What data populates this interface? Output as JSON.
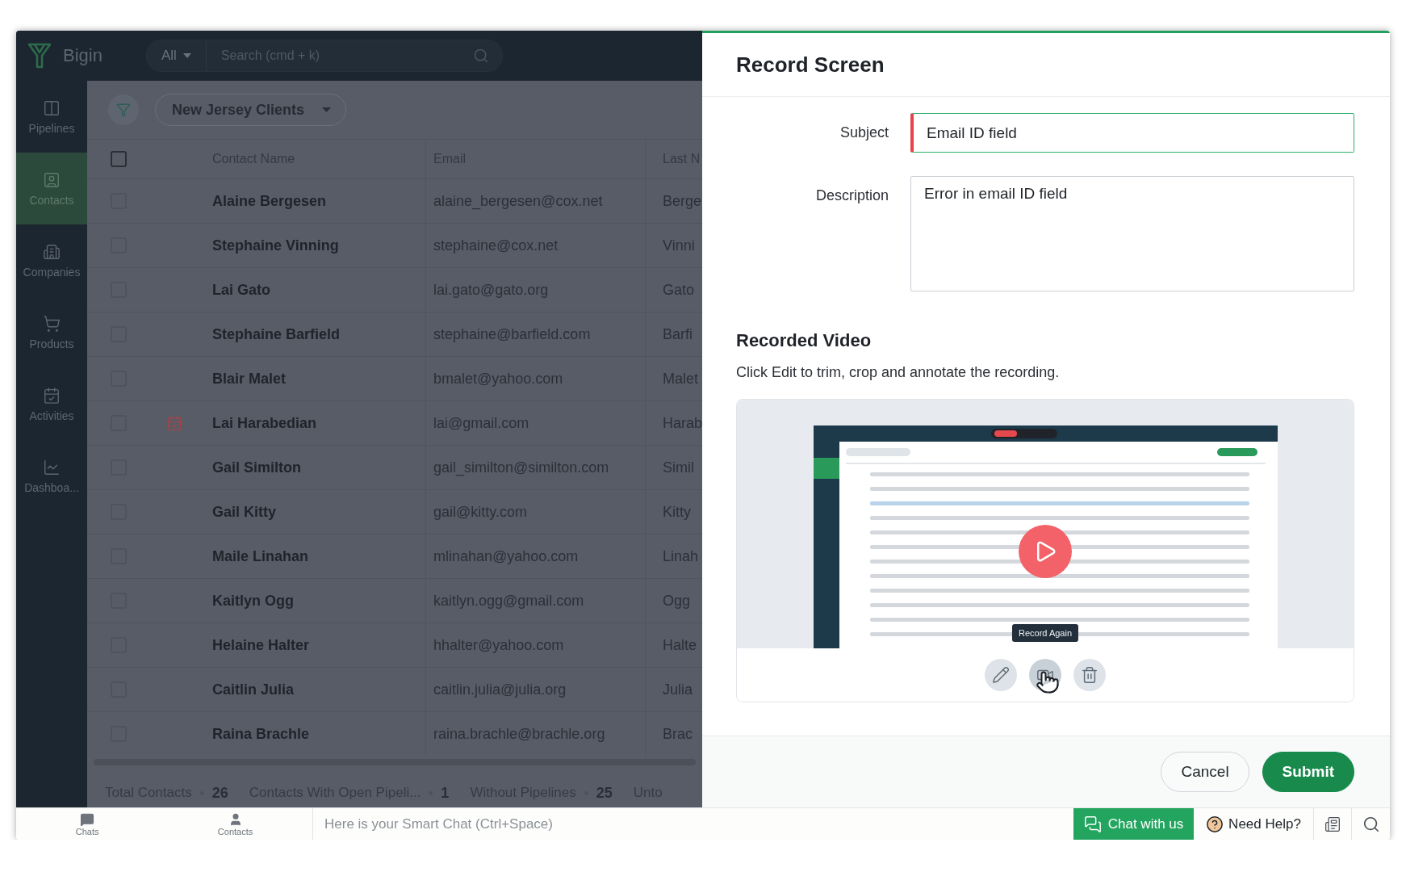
{
  "header": {
    "logo": "Bigin",
    "scope": "All",
    "search_placeholder": "Search (cmd + k)"
  },
  "sidebar": {
    "items": [
      {
        "label": "Pipelines",
        "selected": false
      },
      {
        "label": "Contacts",
        "selected": true
      },
      {
        "label": "Companies",
        "selected": false
      },
      {
        "label": "Products",
        "selected": false
      },
      {
        "label": "Activities",
        "selected": false
      },
      {
        "label": "Dashboa...",
        "selected": false
      }
    ]
  },
  "toolbar": {
    "view": "New Jersey Clients"
  },
  "table": {
    "select_all": {
      "checked": false
    },
    "columns": [
      "Contact Name",
      "Email",
      "Last N"
    ],
    "rows": [
      {
        "checked": false,
        "activity": false,
        "cells": [
          "Alaine Bergesen",
          "alaine_bergesen@cox.net",
          "Berge"
        ]
      },
      {
        "checked": false,
        "activity": false,
        "cells": [
          "Stephaine Vinning",
          "stephaine@cox.net",
          "Vinni"
        ]
      },
      {
        "checked": false,
        "activity": false,
        "cells": [
          "Lai Gato",
          "lai.gato@gato.org",
          "Gato"
        ]
      },
      {
        "checked": false,
        "activity": false,
        "cells": [
          "Stephaine Barfield",
          "stephaine@barfield.com",
          "Barfi"
        ]
      },
      {
        "checked": false,
        "activity": false,
        "cells": [
          "Blair Malet",
          "bmalet@yahoo.com",
          "Malet"
        ]
      },
      {
        "checked": false,
        "activity": true,
        "cells": [
          "Lai Harabedian",
          "lai@gmail.com",
          "Harab"
        ]
      },
      {
        "checked": false,
        "activity": false,
        "cells": [
          "Gail Similton",
          "gail_similton@similton.com",
          "Simil"
        ]
      },
      {
        "checked": false,
        "activity": false,
        "cells": [
          "Gail Kitty",
          "gail@kitty.com",
          "Kitty"
        ]
      },
      {
        "checked": false,
        "activity": false,
        "cells": [
          "Maile Linahan",
          "mlinahan@yahoo.com",
          "Linah"
        ]
      },
      {
        "checked": false,
        "activity": false,
        "cells": [
          "Kaitlyn Ogg",
          "kaitlyn.ogg@gmail.com",
          "Ogg"
        ]
      },
      {
        "checked": false,
        "activity": false,
        "cells": [
          "Helaine Halter",
          "hhalter@yahoo.com",
          "Halte"
        ]
      },
      {
        "checked": false,
        "activity": false,
        "cells": [
          "Caitlin Julia",
          "caitlin.julia@julia.org",
          "Julia"
        ]
      },
      {
        "checked": false,
        "activity": false,
        "cells": [
          "Raina Brachle",
          "raina.brachle@brachle.org",
          "Brac"
        ]
      }
    ]
  },
  "summary": [
    {
      "label": "Total Contacts",
      "value": "26"
    },
    {
      "label": "Contacts With Open Pipeli...",
      "value": "1"
    },
    {
      "label": "Without Pipelines",
      "value": "25"
    },
    {
      "label": "Unto"
    }
  ],
  "dialog": {
    "title": "Record Screen",
    "fields": [
      {
        "kind": "input",
        "label": "Subject",
        "value": "Email ID field",
        "required": true,
        "focused": true
      },
      {
        "kind": "textarea",
        "label": "Description",
        "value": "Error in email ID field",
        "required": false,
        "focused": false
      }
    ],
    "video": {
      "heading": "Recorded Video",
      "caption": "Click Edit to trim, crop and annotate the recording.",
      "tooltip": "Record Again",
      "actions": [
        {
          "hovered": false
        },
        {
          "hovered": true
        },
        {
          "hovered": false
        }
      ]
    },
    "buttons": [
      {
        "label": "Cancel",
        "kind": "secondary"
      },
      {
        "label": "Submit",
        "kind": "primary"
      }
    ]
  },
  "bottom_bar": {
    "tabs": [
      {
        "label": "Chats"
      },
      {
        "label": "Contacts"
      }
    ],
    "chat_placeholder": "Here is your Smart Chat (Ctrl+Space)",
    "chat_button": "Chat with us",
    "help": "Need Help?"
  }
}
